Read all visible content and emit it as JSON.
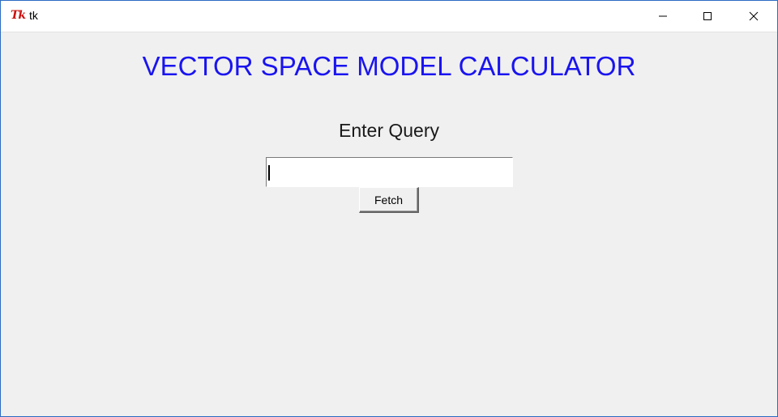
{
  "window": {
    "icon_text": "Tk",
    "title": "tk"
  },
  "main": {
    "heading": "VECTOR SPACE MODEL CALCULATOR",
    "query_label": "Enter Query",
    "query_value": "",
    "fetch_label": "Fetch"
  },
  "colors": {
    "heading": "#1a14ef",
    "background": "#f0f0f0",
    "icon": "#cc1111"
  }
}
